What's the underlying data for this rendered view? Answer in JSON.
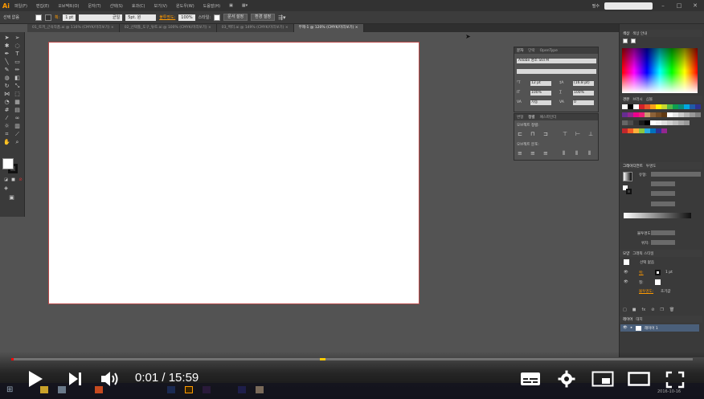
{
  "app": {
    "logo": "Ai"
  },
  "menubar": {
    "items": [
      "파일(F)",
      "편집(E)",
      "오브젝트(O)",
      "문자(T)",
      "선택(S)",
      "효과(C)",
      "보기(V)",
      "윈도우(W)",
      "도움말(H)"
    ],
    "right_label": "필수"
  },
  "controlbar": {
    "selection_label": "선택 없음",
    "stroke_label": "획:",
    "stroke_weight": "1 pt",
    "stroke_style": "균일",
    "brush": "5pt. 원",
    "opacity_label": "불투명도:",
    "opacity_value": "100%",
    "style_label": "스타일:",
    "doc_setup_button": "문서 설정",
    "prefs_button": "환경 설정"
  },
  "tabs": [
    {
      "label": "01_토끼_근육작품.ai @ 116% (CMYK/미리보기)",
      "active": false
    },
    {
      "label": "02_선택툴_도구_튜토.ai @ 100% (CMYK/미리보기)",
      "active": false
    },
    {
      "label": "03_벡터.ai @ 149% (CMYK/미리보기)",
      "active": false
    },
    {
      "label": "무제-1 @ 120% (CMYK/미리보기)",
      "active": true
    }
  ],
  "character_panel": {
    "tabs": [
      "문자",
      "단락",
      "OpenType"
    ],
    "font_family": "Adobe 명조 Std M",
    "font_style": "",
    "size": "12 pt",
    "leading": "(16.8 pt)",
    "scale_v": "100%",
    "scale_h": "100%",
    "kerning": "자동",
    "tracking": "0"
  },
  "align_panel": {
    "tabs": [
      "변형",
      "정렬",
      "패스파인더"
    ],
    "align_objects_label": "오브젝트 정렬:",
    "distribute_objects_label": "오브젝트 분포:"
  },
  "color_panel": {
    "tabs": [
      "색상",
      "색상 안내"
    ]
  },
  "swatches_panel": {
    "tabs": [
      "견본",
      "브러시",
      "심볼"
    ]
  },
  "gradient_panel": {
    "tabs": [
      "그레이디언트",
      "투명도"
    ],
    "type_label": "유형:",
    "opacity_label": "불투명도:",
    "location_label": "위치:"
  },
  "appearance_panel": {
    "tabs": [
      "모양",
      "그래픽 스타일"
    ],
    "title": "선택 없음",
    "stroke_label": "획:",
    "stroke_value": "1 pt",
    "fill_label": "칠:",
    "opacity_label": "불투명도:",
    "opacity_value": "초기값"
  },
  "layers_panel": {
    "tabs": [
      "레이어",
      "대지"
    ],
    "layer_name": "레이어 1"
  },
  "video": {
    "current_time": "0:01",
    "duration": "15:59",
    "progress": 0.001
  },
  "taskbar": {
    "clock_date": "2016-10-16"
  },
  "colors": {
    "artboard_border": "#b84a4a",
    "accent_orange": "#ff9a00",
    "progress_red": "#ff0000",
    "chapter_yellow": "#ffcc00"
  }
}
